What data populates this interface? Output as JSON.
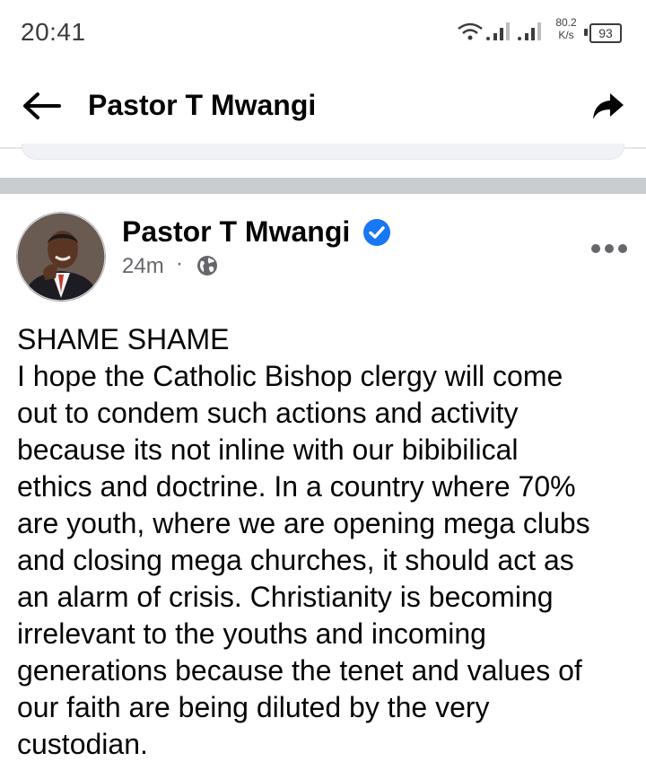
{
  "status_bar": {
    "time": "20:41",
    "net_speed_value": "80.2",
    "net_speed_unit": "K/s",
    "battery": "93",
    "icons": [
      "wifi-icon",
      "signal-icon",
      "signal-icon",
      "battery-icon"
    ]
  },
  "header": {
    "title": "Pastor T Mwangi",
    "back_icon": "arrow-left-icon",
    "share_icon": "share-arrow-icon"
  },
  "post": {
    "author": "Pastor T Mwangi",
    "verified_icon": "verified-badge-icon",
    "time_ago": "24m",
    "separator": "·",
    "audience_icon": "globe-icon",
    "more_icon": "more-options-icon",
    "text": "SHAME SHAME\nI hope the Catholic Bishop clergy will come\nout to condem such actions and activity\nbecause its not inline with our bibibilical\nethics and doctrine. In a country where 70%\nare youth, where we are opening mega clubs\nand closing mega churches, it should act as\nan alarm of crisis. Christianity is becoming\nirrelevant to the youths and incoming\ngenerations because the tenet and values of\nour faith are being diluted by the very\ncustodian."
  },
  "colors": {
    "text_primary": "#050505",
    "text_secondary": "#65676b",
    "verified_blue": "#1877f2",
    "divider": "#c9ccd1"
  }
}
